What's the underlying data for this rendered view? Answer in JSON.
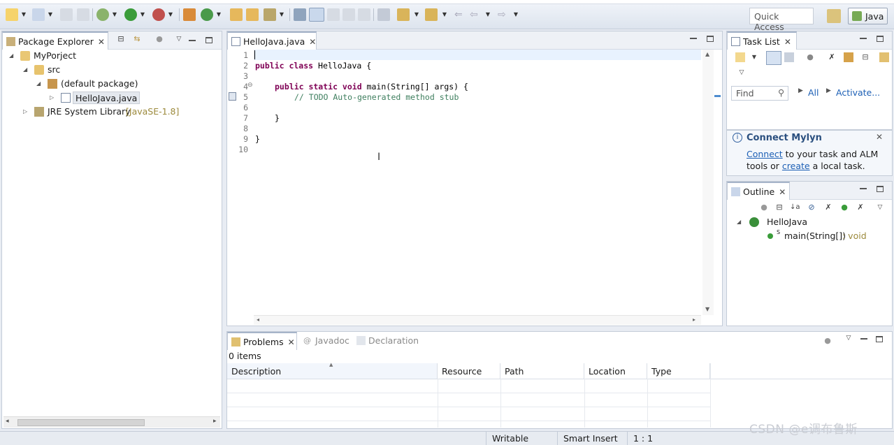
{
  "toolbar": {
    "quick_access_placeholder": "Quick Access",
    "perspective_label": "Java",
    "icons": [
      "new-icon",
      "new-package-icon",
      "save-icon",
      "save-all-icon",
      "debug-icon",
      "run-icon",
      "external-tools-icon",
      "new-java-project-icon",
      "new-class-icon",
      "open-type-icon",
      "search-icon",
      "mark-occurrences-icon",
      "toggle-highlight-icon",
      "next-annotation-icon",
      "prev-annotation-icon",
      "back-icon",
      "forward-icon"
    ]
  },
  "package_explorer": {
    "tab_label": "Package Explorer",
    "tree": {
      "project": "MyPorject",
      "src": "src",
      "package": "(default package)",
      "file": "HelloJava.java",
      "jre": "JRE System Library",
      "jre_version": "[JavaSE-1.8]"
    }
  },
  "editor": {
    "tab_label": "HelloJava.java",
    "line_numbers": [
      "1",
      "2",
      "3",
      "4",
      "5",
      "6",
      "7",
      "8",
      "9",
      "10"
    ],
    "fold_marker": "⊖",
    "lines": {
      "l2_kw": "public class",
      "l2_rest": " HelloJava {",
      "l4_kw": "public static void",
      "l4_rest": " main(String[] args) {",
      "l5_comment": "// TODO Auto-generated method stub",
      "l7": "}",
      "l9": "}"
    }
  },
  "task_list": {
    "tab_label": "Task List",
    "find_placeholder": "Find",
    "all_label": "All",
    "activate_label": "Activate..."
  },
  "mylyn": {
    "title": "Connect Mylyn",
    "connect_link": "Connect",
    "text1": " to your task and ALM",
    "text2_pre": "tools or ",
    "create_link": "create",
    "text2_post": " a local task."
  },
  "outline": {
    "tab_label": "Outline",
    "class_name": "HelloJava",
    "method_sup": "S",
    "method_name": "main(String[])",
    "method_type": " : void"
  },
  "problems": {
    "tabs": {
      "problems": "Problems",
      "javadoc": "Javadoc",
      "declaration": "Declaration"
    },
    "count": "0 items",
    "columns": [
      "Description",
      "Resource",
      "Path",
      "Location",
      "Type"
    ]
  },
  "status": {
    "writable": "Writable",
    "insert_mode": "Smart Insert",
    "position": "1 : 1"
  },
  "watermark": "CSDN @e调布鲁斯",
  "colors": {
    "keyword": "#7f0055",
    "comment": "#3f7f5f",
    "link": "#1c5fb5"
  }
}
